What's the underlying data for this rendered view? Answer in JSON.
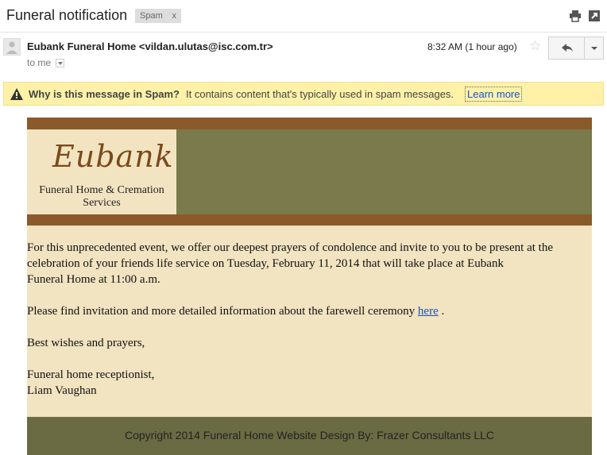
{
  "header": {
    "subject": "Funeral notification",
    "label": "Spam",
    "label_close": "x"
  },
  "message": {
    "sender_name": "Eubank Funeral Home",
    "sender_email": "<vildan.ulutas@isc.com.tr>",
    "recipient": "to me",
    "time": "8:32 AM (1 hour ago)"
  },
  "spam_banner": {
    "question": "Why is this message in Spam?",
    "explanation": "It contains content that's typically used in spam messages.",
    "learn_more": "Learn more"
  },
  "email": {
    "logo_name": "Eubank",
    "logo_subtitle_line1": "Funeral Home & Cremation",
    "logo_subtitle_line2": "Services",
    "paragraph1_line1": "For this unprecedented event, we offer our deepest prayers of condolence and invite to you to be present at the",
    "paragraph1_line2": "celebration of your friends life service on Tuesday, February 11, 2014 that will take place at Eubank",
    "paragraph1_line3": "Funeral Home at 11:00 a.m.",
    "paragraph2": "Please find invitation and more detailed information about the farewell ceremony",
    "link_text": "here",
    "paragraph2_end": ".",
    "closing": "Best wishes and prayers,",
    "signature_title": "Funeral home receptionist,",
    "signature_name": "Liam Vaughan",
    "footer": "Copyright 2014 Funeral Home Website Design By: Frazer Consultants LLC"
  },
  "colors": {
    "brown_bar": "#8b5a2b",
    "olive": "#7a7a4c",
    "cream": "#f2e4c1",
    "banner": "#fff1a8"
  },
  "icons": [
    "print-icon",
    "new-window-icon",
    "avatar-icon",
    "star-icon",
    "reply-icon",
    "dropdown-icon",
    "warning-icon"
  ]
}
